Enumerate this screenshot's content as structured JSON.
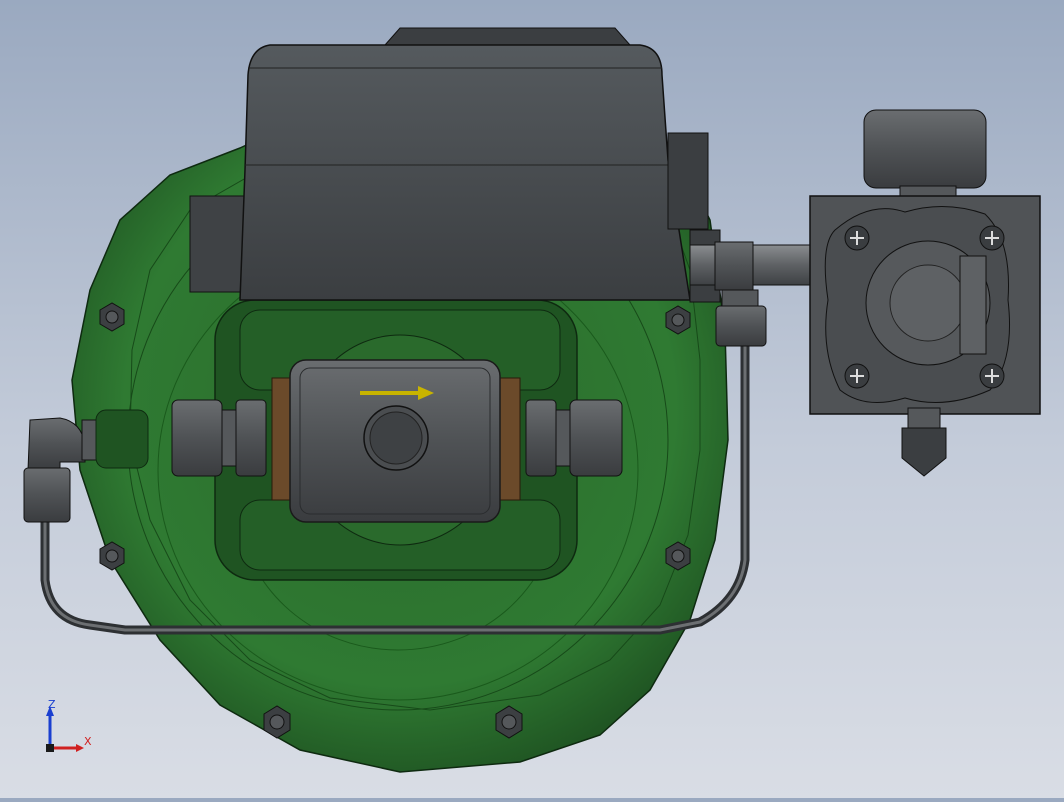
{
  "viewport": {
    "background_top": "#9aa9c0",
    "background_bottom": "#d9dde5"
  },
  "model": {
    "body_color": "#2f6b30",
    "body_dark": "#1f4d22",
    "housing_color": "#4a4d50",
    "housing_dark": "#2f3235",
    "flow_arrow_color": "#c8b400",
    "brown_color": "#6b4a2a"
  },
  "triad": {
    "z_label": "Z",
    "x_label": "X",
    "z_color": "#1a3fd0",
    "x_color": "#d02020"
  }
}
